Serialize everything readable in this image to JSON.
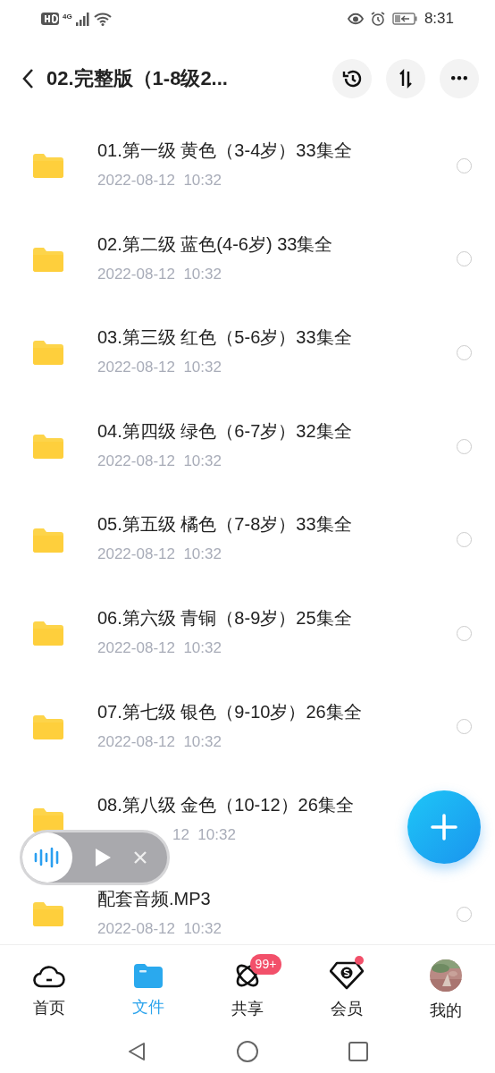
{
  "status_bar": {
    "time": "8:31",
    "network": "4G"
  },
  "header": {
    "title": "02.完整版（1-8级2..."
  },
  "files": [
    {
      "name": "01.第一级 黄色（3-4岁）33集全",
      "date": "2022-08-12  10:32",
      "selected": false
    },
    {
      "name": "02.第二级 蓝色(4-6岁) 33集全",
      "date": "2022-08-12  10:32",
      "selected": false
    },
    {
      "name": "03.第三级 红色（5-6岁）33集全",
      "date": "2022-08-12  10:32",
      "selected": false
    },
    {
      "name": "04.第四级 绿色（6-7岁）32集全",
      "date": "2022-08-12  10:32",
      "selected": false
    },
    {
      "name": "05.第五级 橘色（7-8岁）33集全",
      "date": "2022-08-12  10:32",
      "selected": false
    },
    {
      "name": "06.第六级 青铜（8-9岁）25集全",
      "date": "2022-08-12  10:32",
      "selected": false
    },
    {
      "name": "07.第七级 银色（9-10岁）26集全",
      "date": "2022-08-12  10:32",
      "selected": false
    },
    {
      "name": "08.第八级 金色（10-12）26集全",
      "date": "12  10:32",
      "kind": "covered"
    },
    {
      "name": "配套音频.MP3",
      "date": "2022-08-12  10:32",
      "selected": false
    }
  ],
  "bottom_nav": [
    {
      "label": "首页",
      "selected": false
    },
    {
      "label": "文件",
      "selected": true
    },
    {
      "label": "共享",
      "badge": "99+",
      "selected": false
    },
    {
      "label": "会员",
      "dot": true,
      "selected": false
    },
    {
      "label": "我的",
      "selected": false
    }
  ]
}
